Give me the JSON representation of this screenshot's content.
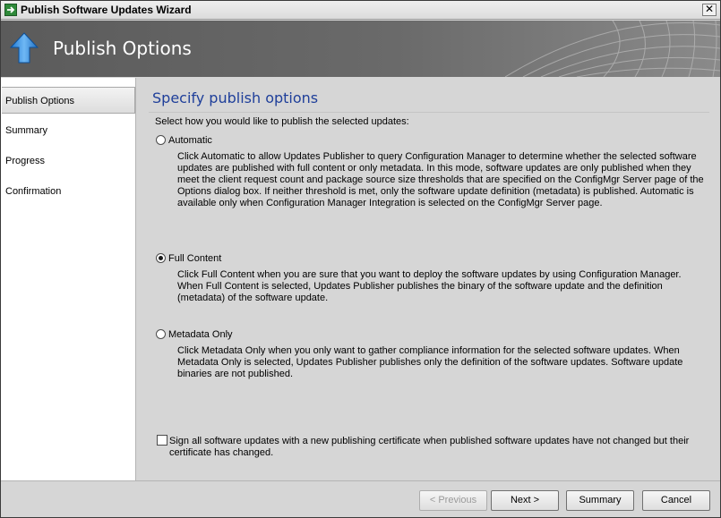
{
  "window": {
    "title": "Publish Software Updates Wizard",
    "close_glyph": "✕"
  },
  "banner": {
    "title": "Publish Options"
  },
  "sidebar": {
    "items": [
      {
        "label": "Publish Options",
        "active": true
      },
      {
        "label": "Summary",
        "active": false
      },
      {
        "label": "Progress",
        "active": false
      },
      {
        "label": "Confirmation",
        "active": false
      }
    ]
  },
  "main": {
    "heading": "Specify publish options",
    "prompt": "Select how you would like to publish the selected updates:",
    "options": [
      {
        "label": "Automatic",
        "selected": false,
        "description": "Click Automatic to allow Updates Publisher to query  Configuration Manager to determine whether the selected software updates are published with full content or only metadata. In this mode, software updates are only published when they meet the client request count and package source size thresholds that are specified on the ConfigMgr Server page of the Options dialog box. If neither threshold is met, only the software update definition (metadata) is published. Automatic is available only when Configuration Manager Integration is selected on the ConfigMgr Server page."
      },
      {
        "label": "Full Content",
        "selected": true,
        "description": "Click Full Content when you are sure that you want to deploy the software updates by using Configuration Manager. When Full Content is selected, Updates Publisher publishes the binary of the software update and the definition (metadata) of the software update."
      },
      {
        "label": "Metadata Only",
        "selected": false,
        "description": "Click Metadata Only when you only want to gather compliance information for the selected software updates. When Metadata Only is selected, Updates Publisher publishes only the definition of the software updates. Software update binaries are not published."
      }
    ],
    "sign_checkbox": {
      "checked": false,
      "label": "Sign all software updates with a new publishing certificate when published software updates have not changed but their certificate has changed."
    }
  },
  "footer": {
    "previous_label": "< Previous",
    "next_label": "Next >",
    "summary_label": "Summary",
    "cancel_label": "Cancel"
  }
}
